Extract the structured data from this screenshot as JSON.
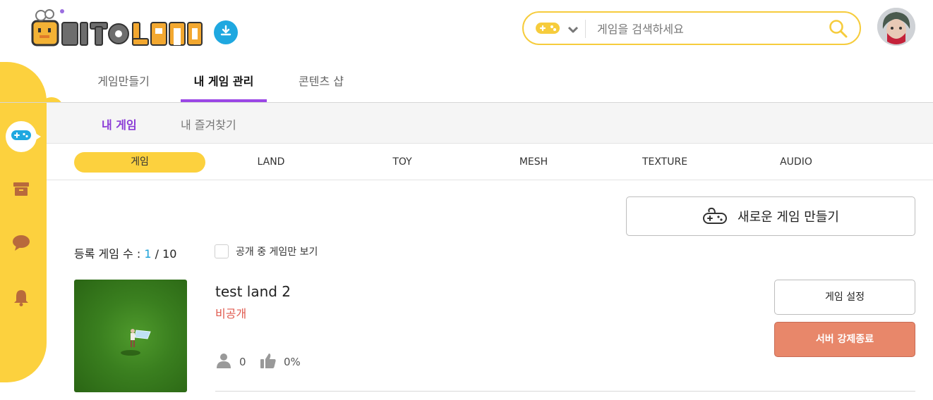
{
  "header": {
    "logo_text": "DITOLAND",
    "search": {
      "placeholder": "게임을 검색하세요",
      "value": ""
    }
  },
  "top_tabs": [
    {
      "label": "게임만들기",
      "active": false
    },
    {
      "label": "내 게임 관리",
      "active": true
    },
    {
      "label": "콘텐츠 샵",
      "active": false
    }
  ],
  "sub_tabs": [
    {
      "label": "내 게임",
      "active": true
    },
    {
      "label": "내 즐겨찾기",
      "active": false
    }
  ],
  "categories": [
    {
      "label": "게임",
      "active": true
    },
    {
      "label": "LAND",
      "active": false
    },
    {
      "label": "TOY",
      "active": false
    },
    {
      "label": "MESH",
      "active": false
    },
    {
      "label": "TEXTURE",
      "active": false
    },
    {
      "label": "AUDIO",
      "active": false
    }
  ],
  "new_game_button": "새로운 게임 만들기",
  "registered": {
    "label": "등록 게임 수 :",
    "current": "1",
    "separator": "/",
    "max": "10"
  },
  "filter_label": "공개 중 게임만 보기",
  "game": {
    "title": "test land 2",
    "status": "비공개",
    "players": "0",
    "likes": "0%",
    "settings_button": "게임 설정",
    "shutdown_button": "서버 강제종료"
  },
  "colors": {
    "accent_yellow": "#fcd13e",
    "active_tab_purple": "#9b46e6",
    "status_red": "#e05a4e",
    "shutdown_orange": "#e8876a",
    "download_blue": "#1fa8e0"
  },
  "icons": [
    "download-icon",
    "gamepad-icon",
    "chevron-down-icon",
    "search-icon",
    "chevron-right-icon",
    "archive-icon",
    "chat-icon",
    "bell-icon",
    "user-icon",
    "thumbs-up-icon"
  ]
}
